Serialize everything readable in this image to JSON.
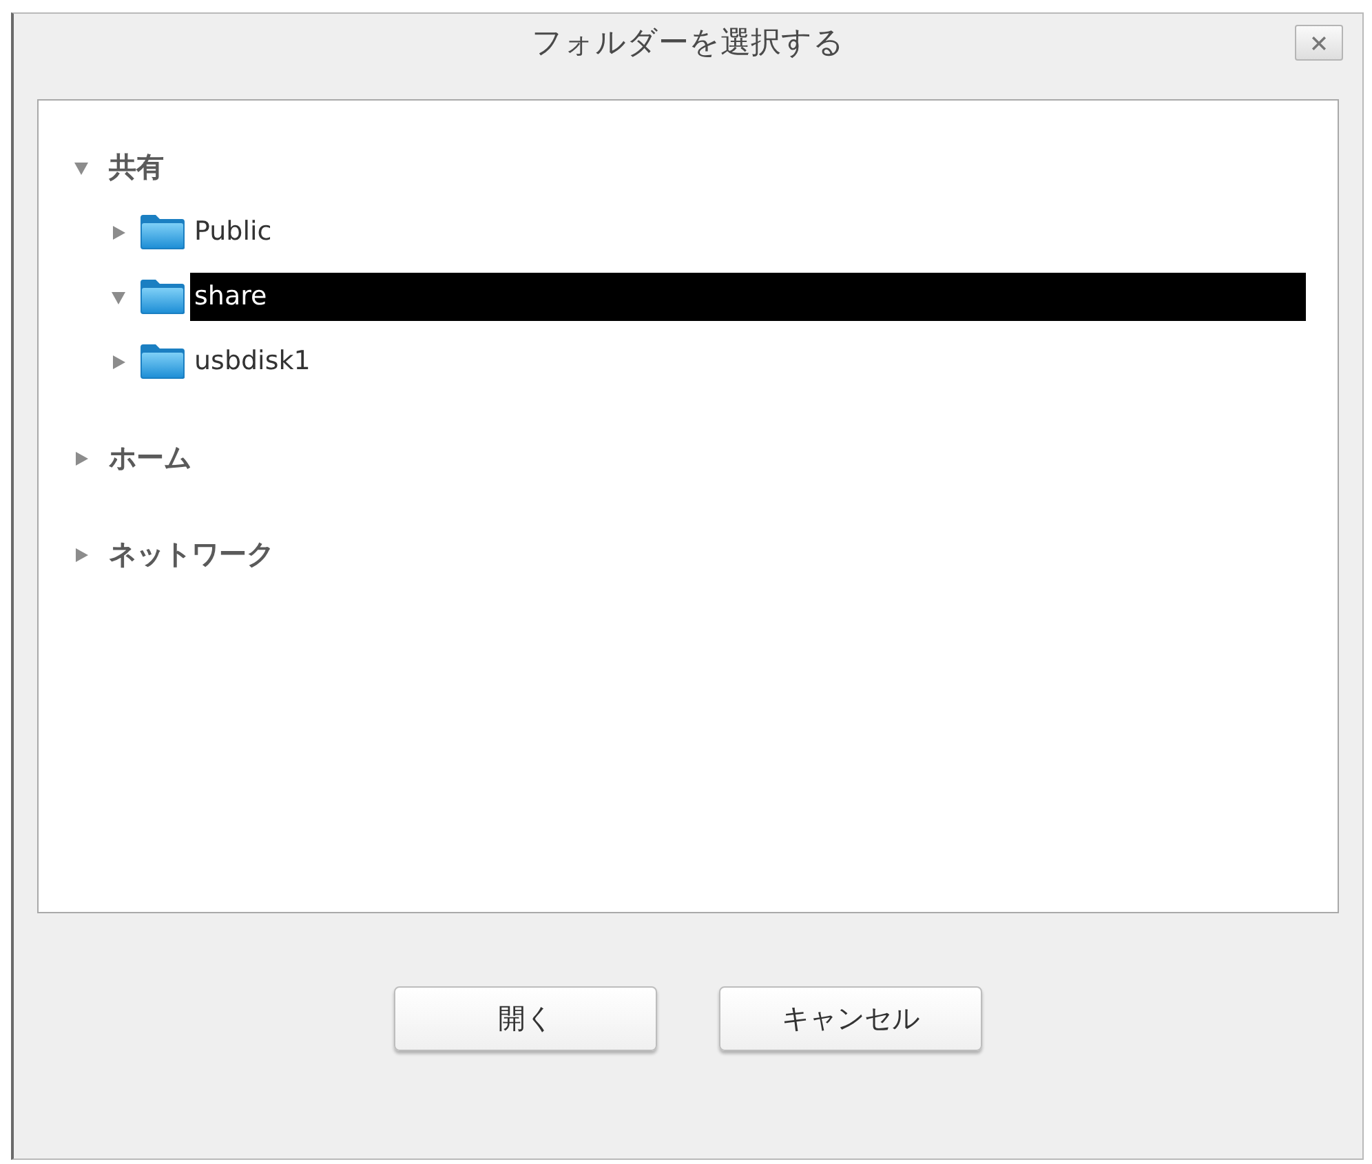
{
  "dialog": {
    "title": "フォルダーを選択する"
  },
  "tree": [
    {
      "label": "共有",
      "expanded": true,
      "selected": false,
      "children": [
        {
          "label": "Public",
          "expanded": false,
          "selected": false
        },
        {
          "label": "share",
          "expanded": true,
          "selected": true
        },
        {
          "label": "usbdisk1",
          "expanded": false,
          "selected": false
        }
      ]
    },
    {
      "label": "ホーム",
      "expanded": false,
      "selected": false
    },
    {
      "label": "ネットワーク",
      "expanded": false,
      "selected": false
    }
  ],
  "buttons": [
    {
      "label": "開く"
    },
    {
      "label": "キャンセル"
    }
  ]
}
